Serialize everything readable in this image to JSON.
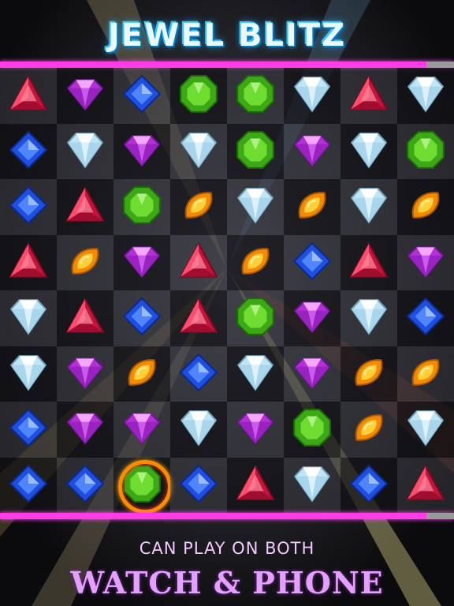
{
  "title": "JEWEL BLITZ",
  "timer": {
    "fraction": 0.94
  },
  "board": {
    "rows": [
      [
        "red",
        "purple",
        "blue",
        "green",
        "green",
        "white",
        "red",
        "white"
      ],
      [
        "blue",
        "white",
        "purple",
        "white",
        "green",
        "purple",
        "white",
        "green"
      ],
      [
        "blue",
        "red",
        "green",
        "orange",
        "white",
        "orange",
        "white",
        "orange"
      ],
      [
        "red",
        "orange",
        "purple",
        "red",
        "orange",
        "blue",
        "red",
        "purple"
      ],
      [
        "white",
        "red",
        "blue",
        "red",
        "green",
        "purple",
        "white",
        "blue"
      ],
      [
        "white",
        "purple",
        "orange",
        "blue",
        "white",
        "purple",
        "orange",
        "orange"
      ],
      [
        "blue",
        "purple",
        "purple",
        "white",
        "purple",
        "green",
        "orange",
        "white"
      ],
      [
        "blue",
        "blue",
        "green",
        "blue",
        "red",
        "white",
        "blue",
        "red"
      ]
    ],
    "selected": {
      "row": 7,
      "col": 2
    }
  },
  "caption": {
    "line1": "CAN PLAY ON BOTH",
    "line2": "WATCH & PHONE"
  },
  "colors": {
    "accent_pink": "#ff3ce6",
    "title_blue": "#1aa7ff",
    "caption_purple": "#e4a0ff"
  }
}
